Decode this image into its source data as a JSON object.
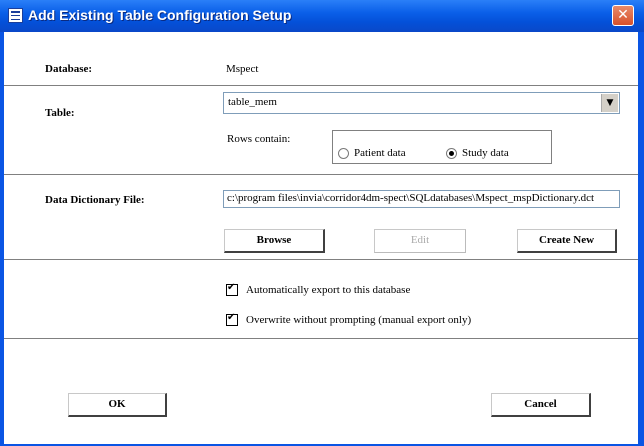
{
  "window": {
    "title": "Add Existing Table Configuration Setup"
  },
  "database": {
    "label": "Database:",
    "value": "Mspect"
  },
  "table": {
    "label": "Table:",
    "selected": "table_mem",
    "rows_contain_label": "Rows contain:",
    "options": [
      {
        "label": "Patient data",
        "selected": false
      },
      {
        "label": "Study data",
        "selected": true
      }
    ]
  },
  "dictionary": {
    "label": "Data Dictionary File:",
    "path": "c:\\program files\\invia\\corridor4dm-spect\\SQLdatabases\\Mspect_mspDictionary.dct",
    "browse_label": "Browse",
    "edit_label": "Edit",
    "create_label": "Create New"
  },
  "options": {
    "auto_export": {
      "label": "Automatically export to this database",
      "checked": true
    },
    "overwrite": {
      "label": "Overwrite without prompting (manual export only)",
      "checked": true
    }
  },
  "footer": {
    "ok_label": "OK",
    "cancel_label": "Cancel"
  },
  "colors": {
    "titlebar": "#0a5fe8",
    "close": "#d8502a"
  }
}
